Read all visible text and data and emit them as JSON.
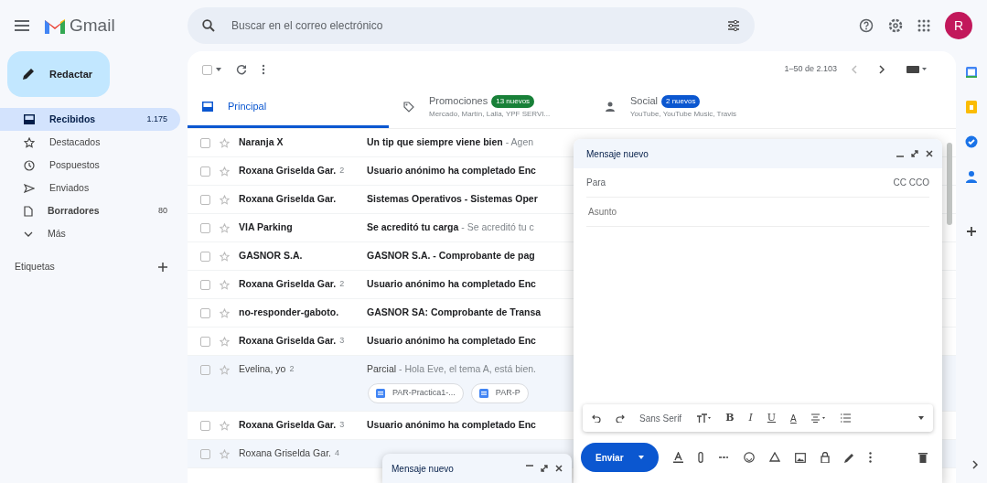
{
  "app": {
    "name": "Gmail"
  },
  "search": {
    "placeholder": "Buscar en el correo electrónico"
  },
  "avatar": {
    "initial": "R"
  },
  "compose_button": "Redactar",
  "folders": [
    {
      "label": "Recibidos",
      "count": "1.175",
      "selected": true,
      "bold": true
    },
    {
      "label": "Destacados",
      "selected": false,
      "bold": false
    },
    {
      "label": "Pospuestos",
      "selected": false,
      "bold": false
    },
    {
      "label": "Enviados",
      "selected": false,
      "bold": false
    },
    {
      "label": "Borradores",
      "count": "80",
      "selected": false,
      "bold": true
    },
    {
      "label": "Más",
      "selected": false,
      "bold": false
    }
  ],
  "labels_heading": "Etiquetas",
  "select_all": {
    "checked": false
  },
  "pagination": "1–50 de 2.103",
  "tabs": [
    {
      "label": "Principal",
      "selected": true
    },
    {
      "label": "Promociones",
      "badge": "13 nuevos",
      "color": "#188038",
      "senders": "Mercado, Martín, Lalla, YPF SERVI...",
      "selected": false
    },
    {
      "label": "Social",
      "badge": "2 nuevos",
      "color": "#0b57d0",
      "senders": "YouTube, YouTube Music, Travis",
      "selected": false
    }
  ],
  "emails": [
    {
      "sender": "Naranja X",
      "subject": "Un tip que siempre viene bien",
      "snippet": " - Agen",
      "unread": true,
      "checked": false
    },
    {
      "sender": "Roxana Griselda Gar.",
      "count": "2",
      "subject": "Usuario anónimo ha completado Enc",
      "unread": true,
      "checked": false
    },
    {
      "sender": "Roxana Griselda Gar.",
      "subject": "Sistemas Operativos - Sistemas Oper",
      "unread": true,
      "checked": false
    },
    {
      "sender": "VIA Parking",
      "subject": "Se acreditó tu carga",
      "snippet": " - Se acreditó tu c",
      "unread": true,
      "checked": false
    },
    {
      "sender": "GASNOR S.A.",
      "subject": "GASNOR S.A. - Comprobante de pag",
      "unread": true,
      "checked": false
    },
    {
      "sender": "Roxana Griselda Gar.",
      "count": "2",
      "subject": "Usuario anónimo ha completado Enc",
      "unread": true,
      "checked": false
    },
    {
      "sender": "no-responder-gaboto.",
      "subject": "GASNOR SA: Comprobante de Transa",
      "unread": true,
      "checked": false
    },
    {
      "sender": "Roxana Griselda Gar.",
      "count": "3",
      "subject": "Usuario anónimo ha completado Enc",
      "unread": true,
      "checked": false
    },
    {
      "sender": "Evelina, yo",
      "count": "2",
      "subject": "Parcial",
      "snippet": " - Hola Eve, el tema A, está bien.",
      "unread": false,
      "checked": false,
      "attachments": [
        "PAR-Practica1-...",
        "PAR-P"
      ]
    },
    {
      "sender": "Roxana Griselda Gar.",
      "count": "3",
      "subject": "Usuario anónimo ha completado Enc",
      "unread": true,
      "checked": false
    },
    {
      "sender": "Roxana Griselda Gar.",
      "count": "4",
      "unread": false,
      "checked": false
    }
  ],
  "compose": {
    "title": "Mensaje nuevo",
    "to_label": "Para",
    "cc": "CC CCO",
    "subject_placeholder": "Asunto",
    "font": "Sans Serif",
    "format": [
      "B",
      "I",
      "U"
    ],
    "color_letter": "A",
    "send": "Enviar"
  },
  "minimized_compose": {
    "title": "Mensaje nuevo"
  }
}
